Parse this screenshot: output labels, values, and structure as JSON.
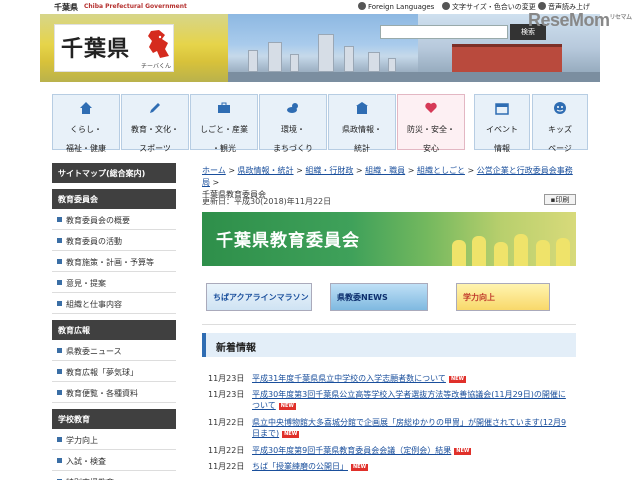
{
  "header": {
    "pref_name": "千葉県",
    "pref_name_en": "Chiba Prefectural Government",
    "util_links": [
      "Foreign Languages",
      "文字サイズ・色合いの変更",
      "音声読み上げ"
    ],
    "logo_title": "千葉県",
    "logo_mascot_label": "チーバくん",
    "search_button": "検索",
    "watermark": "ReseMom",
    "watermark_sub": "リセマム"
  },
  "gnav": [
    {
      "label": "くらし・\n福祉・健康",
      "icon": "house-icon"
    },
    {
      "label": "教育・文化・\nスポーツ",
      "icon": "pencil-icon"
    },
    {
      "label": "しごと・産業\n・観光",
      "icon": "briefcase-icon"
    },
    {
      "label": "環境・\nまちづくり",
      "icon": "cloud-sun-icon"
    },
    {
      "label": "県政情報・\n統計",
      "icon": "building-icon"
    },
    {
      "label": "防災・安全・\n安心",
      "icon": "heart-icon"
    },
    {
      "label": "イベント\n情報",
      "icon": "calendar-icon"
    },
    {
      "label": "キッズ\nページ",
      "icon": "smiley-icon"
    }
  ],
  "sidebar": {
    "sections": [
      {
        "title": "サイトマップ(総合案内)",
        "items": []
      },
      {
        "title": "教育委員会",
        "items": [
          "教育委員会の概要",
          "教育委員の活動",
          "教育施策・計画・予算等",
          "意見・提案",
          "組織と仕事内容"
        ]
      },
      {
        "title": "教育広報",
        "items": [
          "県教委ニュース",
          "教育広報「夢気球」",
          "教育便覧・各種資料"
        ]
      },
      {
        "title": "学校教育",
        "items": [
          "学力向上",
          "入試・検査",
          "特別支援教育"
        ]
      }
    ]
  },
  "breadcrumb": {
    "items": [
      "ホーム",
      "県政情報・統計",
      "組織・行財政",
      "組織・職員",
      "組織としごと",
      "公営企業と行政委員会事務局"
    ],
    "separator": ">",
    "current": "千葉県教育委員会"
  },
  "page": {
    "updated": "更新日：平成30(2018)年11月22日",
    "print_label": "印刷",
    "hero_title": "千葉県教育委員会"
  },
  "banners": [
    "ちばアクアラインマラソン",
    "県教委NEWS",
    "学力向上"
  ],
  "news": {
    "heading": "新着情報",
    "new_label": "NEW",
    "items": [
      {
        "date": "11月23日",
        "text": "平成31年度千葉県県立中学校の入学志願者数について"
      },
      {
        "date": "11月23日",
        "text": "平成30年度第3回千葉県公立高等学校入学者選抜方法等改善協議会(11月29日)の開催について"
      },
      {
        "date": "11月22日",
        "text": "県立中央博物館大多喜城分館で企画展「房総ゆかりの甲冑」が開催されています(12月9日まで)"
      },
      {
        "date": "11月22日",
        "text": "平成30年度第9回千葉県教育委員会会議（定例会）結果"
      },
      {
        "date": "11月22日",
        "text": "ちば「授業練磨の公開日」"
      }
    ]
  }
}
